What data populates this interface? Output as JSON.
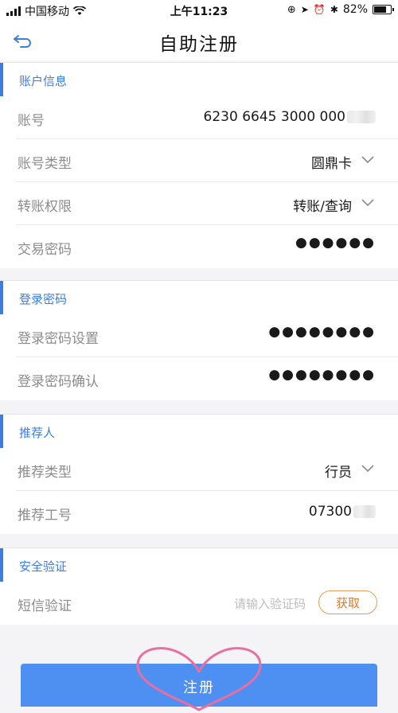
{
  "status_bar": {
    "carrier": "中国移动",
    "time": "上午11:23",
    "battery": "82%",
    "battery_level": 0.82
  },
  "nav": {
    "title": "自助注册",
    "back_icon": "back-arrow-icon"
  },
  "sections": {
    "account": {
      "header": "账户信息",
      "rows": [
        {
          "label": "账号",
          "value": "6230 6645 3000 000"
        },
        {
          "label": "账号类型",
          "value": "圆鼎卡"
        },
        {
          "label": "转账权限",
          "value": "转账/查询"
        },
        {
          "label": "交易密码",
          "value": "●●●●●●"
        }
      ]
    },
    "login": {
      "header": "登录密码",
      "rows": [
        {
          "label": "登录密码设置",
          "value": "●●●●●●●●"
        },
        {
          "label": "登录密码确认",
          "value": "●●●●●●●●"
        }
      ]
    },
    "referrer": {
      "header": "推荐人",
      "rows": [
        {
          "label": "推荐类型",
          "value": "行员"
        },
        {
          "label": "推荐工号",
          "value": "07300"
        }
      ]
    },
    "verify": {
      "header": "安全验证",
      "sms_label": "短信验证",
      "sms_placeholder": "请输入验证码",
      "get_code_button": "获取"
    }
  },
  "footer": {
    "register_button": "注册"
  },
  "colors": {
    "accent": "#3d7de0",
    "button": "#4e8ff2",
    "get_code": "#e07a2a",
    "heart": "#e86fa0"
  }
}
